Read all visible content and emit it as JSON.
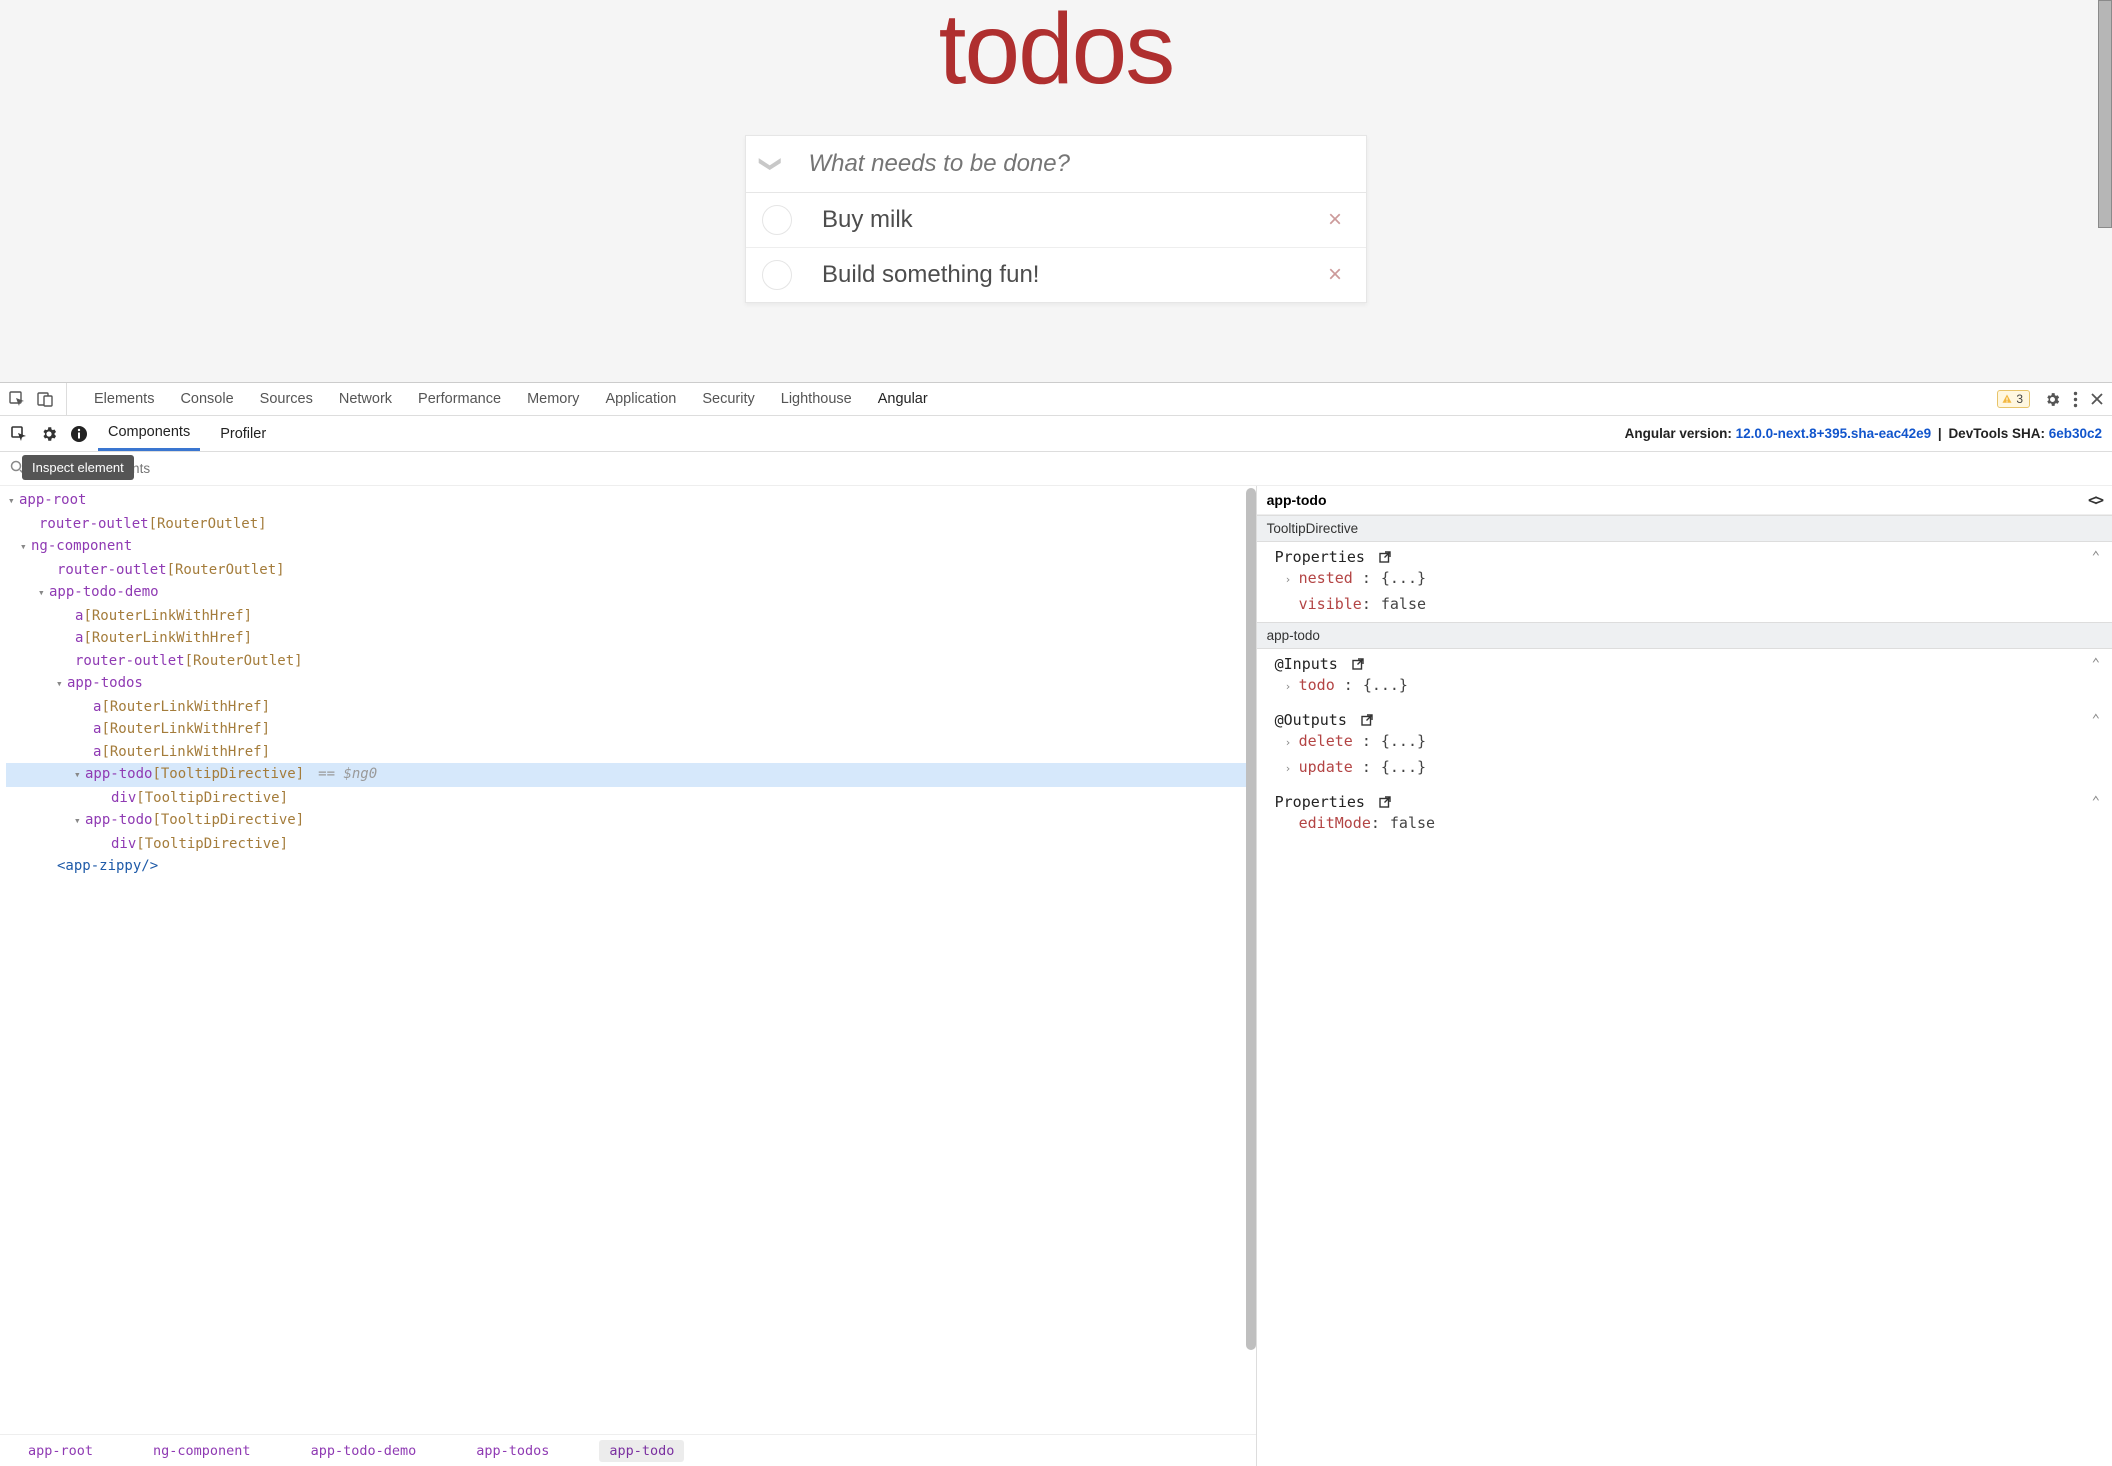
{
  "app": {
    "title": "todos",
    "input_placeholder": "What needs to be done?",
    "items": [
      {
        "label": "Buy milk"
      },
      {
        "label": "Build something fun!"
      }
    ]
  },
  "devtools": {
    "tabs": [
      "Elements",
      "Console",
      "Sources",
      "Network",
      "Performance",
      "Memory",
      "Application",
      "Security",
      "Lighthouse",
      "Angular"
    ],
    "active_tab": "Angular",
    "warning_count": "3"
  },
  "angular": {
    "tabs": [
      "Components",
      "Profiler"
    ],
    "active_tab": "Components",
    "version_prefix": "Angular version: ",
    "version": "12.0.0-next.8+395.sha-eac42e9",
    "sha_label": "DevTools SHA: ",
    "sha": "6eb30c2",
    "search_placeholder": "Search components",
    "tooltip": "Inspect element"
  },
  "tree": {
    "ng0": "== $ng0",
    "crumbs": [
      "app-root",
      "ng-component",
      "app-todo-demo",
      "app-todos",
      "app-todo"
    ]
  },
  "tree_nodes": {
    "app_root": "app-root",
    "router_outlet": "router-outlet",
    "router_outlet_dir": "[RouterOutlet]",
    "ng_component": "ng-component",
    "app_todo_demo": "app-todo-demo",
    "a": "a",
    "a_dir": "[RouterLinkWithHref]",
    "app_todos": "app-todos",
    "app_todo": "app-todo",
    "app_todo_dir": "[TooltipDirective]",
    "div": "div",
    "div_dir": "[TooltipDirective]",
    "app_zippy": "<app-zippy/>"
  },
  "props": {
    "selected": "app-todo",
    "sections": {
      "tooltip": {
        "title": "TooltipDirective",
        "properties_label": "Properties",
        "rows": [
          {
            "key": "nested",
            "val": "{...}",
            "expandable": true
          },
          {
            "key": "visible",
            "val": "false",
            "expandable": false
          }
        ]
      },
      "apptodo": {
        "title": "app-todo",
        "inputs_label": "@Inputs",
        "inputs": [
          {
            "key": "todo",
            "val": "{...}",
            "expandable": true
          }
        ],
        "outputs_label": "@Outputs",
        "outputs": [
          {
            "key": "delete",
            "val": "{...}",
            "expandable": true
          },
          {
            "key": "update",
            "val": "{...}",
            "expandable": true
          }
        ],
        "properties_label": "Properties",
        "properties": [
          {
            "key": "editMode",
            "val": "false",
            "expandable": false
          }
        ]
      }
    }
  }
}
